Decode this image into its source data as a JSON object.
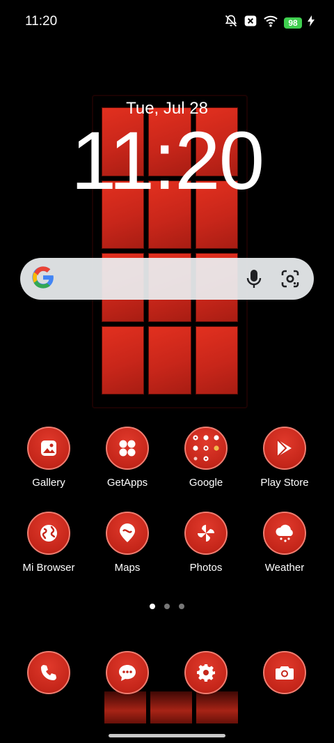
{
  "status_bar": {
    "time": "11:20",
    "icons": [
      "bell-muted-icon",
      "close-box-icon",
      "wifi-icon",
      "battery-icon",
      "charging-bolt-icon"
    ],
    "battery": "98"
  },
  "clock": {
    "date": "Tue, Jul 28",
    "time": "11:20"
  },
  "search": {
    "logo": "google-g-icon",
    "mic": "mic-icon",
    "lens": "lens-icon"
  },
  "apps": [
    {
      "label": "Gallery",
      "icon": "gallery-icon"
    },
    {
      "label": "GetApps",
      "icon": "getapps-icon"
    },
    {
      "label": "Google",
      "icon": "google-folder-icon"
    },
    {
      "label": "Play Store",
      "icon": "play-store-icon"
    },
    {
      "label": "Mi Browser",
      "icon": "globe-icon"
    },
    {
      "label": "Maps",
      "icon": "map-pin-icon"
    },
    {
      "label": "Photos",
      "icon": "pinwheel-icon"
    },
    {
      "label": "Weather",
      "icon": "weather-icon"
    }
  ],
  "dock": [
    {
      "icon": "phone-icon"
    },
    {
      "icon": "messages-icon"
    },
    {
      "icon": "settings-icon"
    },
    {
      "icon": "camera-icon"
    }
  ],
  "pager": {
    "pages": 3,
    "active": 1
  },
  "colors": {
    "icon_red": "#c5261a",
    "icon_border": "#f07d70",
    "battery_green": "#3fcf4f",
    "wallpaper_red": "#d42b1c"
  }
}
